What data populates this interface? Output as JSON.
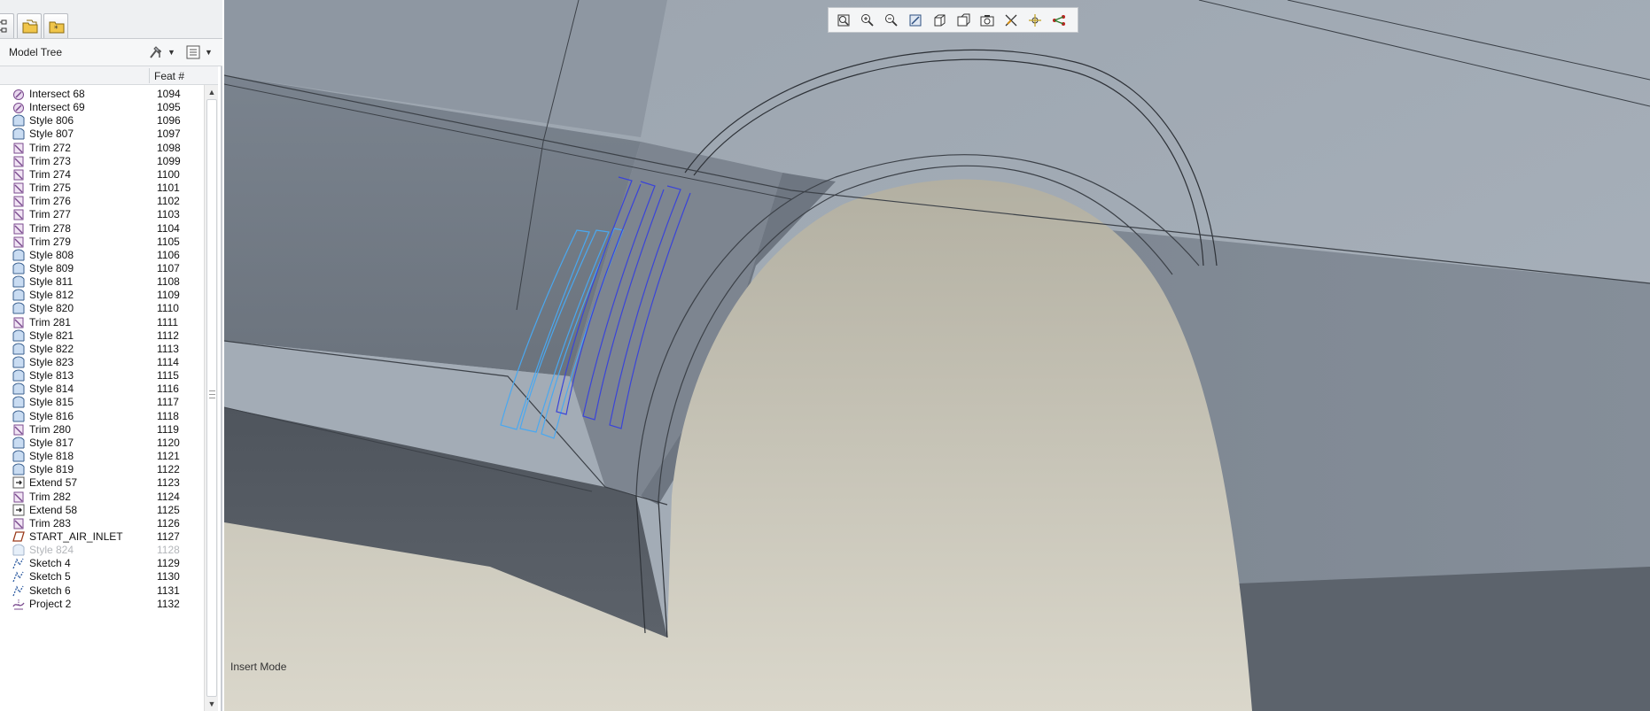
{
  "panel": {
    "tabs": [
      "model-tree-tab",
      "folder-browser-tab",
      "favorites-tab"
    ],
    "tree_title": "Model Tree",
    "column_feat": "Feat #"
  },
  "tree_items": [
    {
      "name": "Intersect 68",
      "num": "1094",
      "icon": "intersect-icon"
    },
    {
      "name": "Intersect 69",
      "num": "1095",
      "icon": "intersect-icon"
    },
    {
      "name": "Style 806",
      "num": "1096",
      "icon": "style-icon"
    },
    {
      "name": "Style 807",
      "num": "1097",
      "icon": "style-icon"
    },
    {
      "name": "Trim 272",
      "num": "1098",
      "icon": "trim-icon"
    },
    {
      "name": "Trim 273",
      "num": "1099",
      "icon": "trim-icon"
    },
    {
      "name": "Trim 274",
      "num": "1100",
      "icon": "trim-icon"
    },
    {
      "name": "Trim 275",
      "num": "1101",
      "icon": "trim-icon"
    },
    {
      "name": "Trim 276",
      "num": "1102",
      "icon": "trim-icon"
    },
    {
      "name": "Trim 277",
      "num": "1103",
      "icon": "trim-icon"
    },
    {
      "name": "Trim 278",
      "num": "1104",
      "icon": "trim-icon"
    },
    {
      "name": "Trim 279",
      "num": "1105",
      "icon": "trim-icon"
    },
    {
      "name": "Style 808",
      "num": "1106",
      "icon": "style-icon"
    },
    {
      "name": "Style 809",
      "num": "1107",
      "icon": "style-icon"
    },
    {
      "name": "Style 811",
      "num": "1108",
      "icon": "style-icon"
    },
    {
      "name": "Style 812",
      "num": "1109",
      "icon": "style-icon"
    },
    {
      "name": "Style 820",
      "num": "1110",
      "icon": "style-icon"
    },
    {
      "name": "Trim 281",
      "num": "1111",
      "icon": "trim-icon"
    },
    {
      "name": "Style 821",
      "num": "1112",
      "icon": "style-icon"
    },
    {
      "name": "Style 822",
      "num": "1113",
      "icon": "style-icon"
    },
    {
      "name": "Style 823",
      "num": "1114",
      "icon": "style-icon"
    },
    {
      "name": "Style 813",
      "num": "1115",
      "icon": "style-icon"
    },
    {
      "name": "Style 814",
      "num": "1116",
      "icon": "style-icon"
    },
    {
      "name": "Style 815",
      "num": "1117",
      "icon": "style-icon"
    },
    {
      "name": "Style 816",
      "num": "1118",
      "icon": "style-icon"
    },
    {
      "name": "Trim 280",
      "num": "1119",
      "icon": "trim-icon"
    },
    {
      "name": "Style 817",
      "num": "1120",
      "icon": "style-icon"
    },
    {
      "name": "Style 818",
      "num": "1121",
      "icon": "style-icon"
    },
    {
      "name": "Style 819",
      "num": "1122",
      "icon": "style-icon"
    },
    {
      "name": "Extend 57",
      "num": "1123",
      "icon": "extend-icon"
    },
    {
      "name": "Trim 282",
      "num": "1124",
      "icon": "trim-icon"
    },
    {
      "name": "Extend 58",
      "num": "1125",
      "icon": "extend-icon"
    },
    {
      "name": "Trim 283",
      "num": "1126",
      "icon": "trim-icon"
    },
    {
      "name": "START_AIR_INLET",
      "num": "1127",
      "icon": "datum-plane-icon"
    },
    {
      "name": "Style 824",
      "num": "1128",
      "icon": "style-icon",
      "suppressed": true
    },
    {
      "name": "Sketch 4",
      "num": "1129",
      "icon": "sketch-icon"
    },
    {
      "name": "Sketch 5",
      "num": "1130",
      "icon": "sketch-icon"
    },
    {
      "name": "Sketch 6",
      "num": "1131",
      "icon": "sketch-icon"
    },
    {
      "name": "Project 2",
      "num": "1132",
      "icon": "project-icon"
    }
  ],
  "view_toolbar": [
    "refit-icon",
    "zoom-in-icon",
    "zoom-out-icon",
    "repaint-icon",
    "display-style-icon",
    "saved-views-icon",
    "view-manager-icon",
    "datum-display-icon",
    "spin-center-icon",
    "annotation-display-icon"
  ],
  "status": {
    "mode": "Insert Mode"
  },
  "colors": {
    "accent_blue": "#3355dd",
    "light_blue": "#4aa8f0",
    "surface": "#b8b5a8"
  }
}
